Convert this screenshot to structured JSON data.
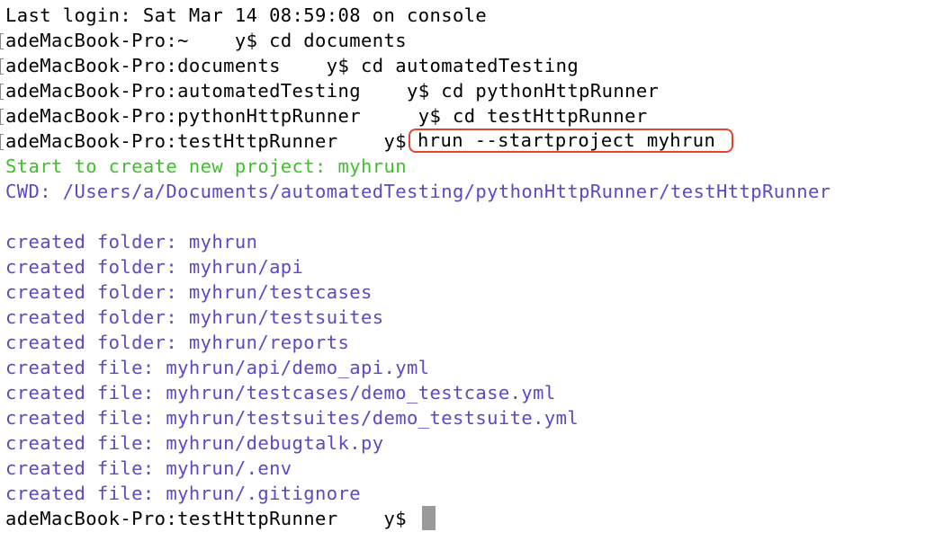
{
  "terminal": {
    "colors": {
      "default": "#000000",
      "success": "#3fbf2c",
      "info": "#5b49c7",
      "highlight": "#e8442a",
      "cursor": "#9a9a9a"
    },
    "last_login": "Last login: Sat Mar 14 08:59:08 on console",
    "commands": [
      {
        "prompt": "adeMacBook-Pro:~ ",
        "user": "   y$ ",
        "cmd": "cd documents"
      },
      {
        "prompt": "adeMacBook-Pro:documents ",
        "user": "   y$ ",
        "cmd": "cd automatedTesting"
      },
      {
        "prompt": "adeMacBook-Pro:automatedTesting ",
        "user": "   y$ ",
        "cmd": "cd pythonHttpRunner"
      },
      {
        "prompt": "adeMacBook-Pro:pythonHttpRunner ",
        "user": "    y$ ",
        "cmd": "cd testHttpRunner"
      },
      {
        "prompt": "adeMacBook-Pro:testHttpRunner ",
        "user": "   y$",
        "cmd": "hrun --startproject myhrun"
      }
    ],
    "start_message": "Start to create new project: myhrun",
    "cwd_message": "CWD: /Users/a/Documents/automatedTesting/pythonHttpRunner/testHttpRunner",
    "created_lines": [
      "created folder: myhrun",
      "created folder: myhrun/api",
      "created folder: myhrun/testcases",
      "created folder: myhrun/testsuites",
      "created folder: myhrun/reports",
      "created file: myhrun/api/demo_api.yml",
      "created file: myhrun/testcases/demo_testcase.yml",
      "created file: myhrun/testsuites/demo_testsuite.yml",
      "created file: myhrun/debugtalk.py",
      "created file: myhrun/.env",
      "created file: myhrun/.gitignore"
    ],
    "final_prompt": {
      "prompt": "adeMacBook-Pro:testHttpRunner ",
      "user": "   y$"
    }
  }
}
